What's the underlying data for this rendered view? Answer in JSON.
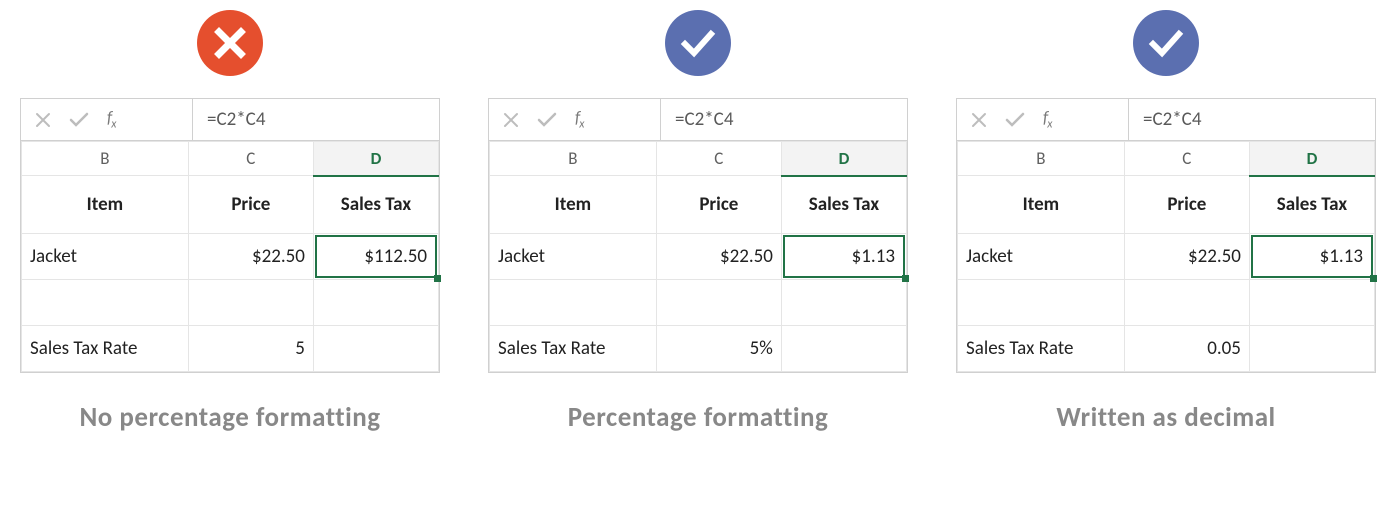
{
  "panels": [
    {
      "badge": "x",
      "formula": "=C2*C4",
      "columns": {
        "b": "B",
        "c": "C",
        "d": "D"
      },
      "headers": {
        "item": "Item",
        "price": "Price",
        "tax": "Sales Tax"
      },
      "row": {
        "item": "Jacket",
        "price": "$22.50",
        "tax": "$112.50"
      },
      "rate": {
        "label": "Sales Tax Rate",
        "value": "5"
      },
      "caption": "No percentage formatting"
    },
    {
      "badge": "check",
      "formula": "=C2*C4",
      "columns": {
        "b": "B",
        "c": "C",
        "d": "D"
      },
      "headers": {
        "item": "Item",
        "price": "Price",
        "tax": "Sales Tax"
      },
      "row": {
        "item": "Jacket",
        "price": "$22.50",
        "tax": "$1.13"
      },
      "rate": {
        "label": "Sales Tax Rate",
        "value": "5%"
      },
      "caption": "Percentage formatting"
    },
    {
      "badge": "check",
      "formula": "=C2*C4",
      "columns": {
        "b": "B",
        "c": "C",
        "d": "D"
      },
      "headers": {
        "item": "Item",
        "price": "Price",
        "tax": "Sales Tax"
      },
      "row": {
        "item": "Jacket",
        "price": "$22.50",
        "tax": "$1.13"
      },
      "rate": {
        "label": "Sales Tax Rate",
        "value": "0.05"
      },
      "caption": "Written as decimal"
    }
  ],
  "icons": {
    "cancel": "close-icon",
    "enter": "check-icon",
    "fx": "fx"
  }
}
